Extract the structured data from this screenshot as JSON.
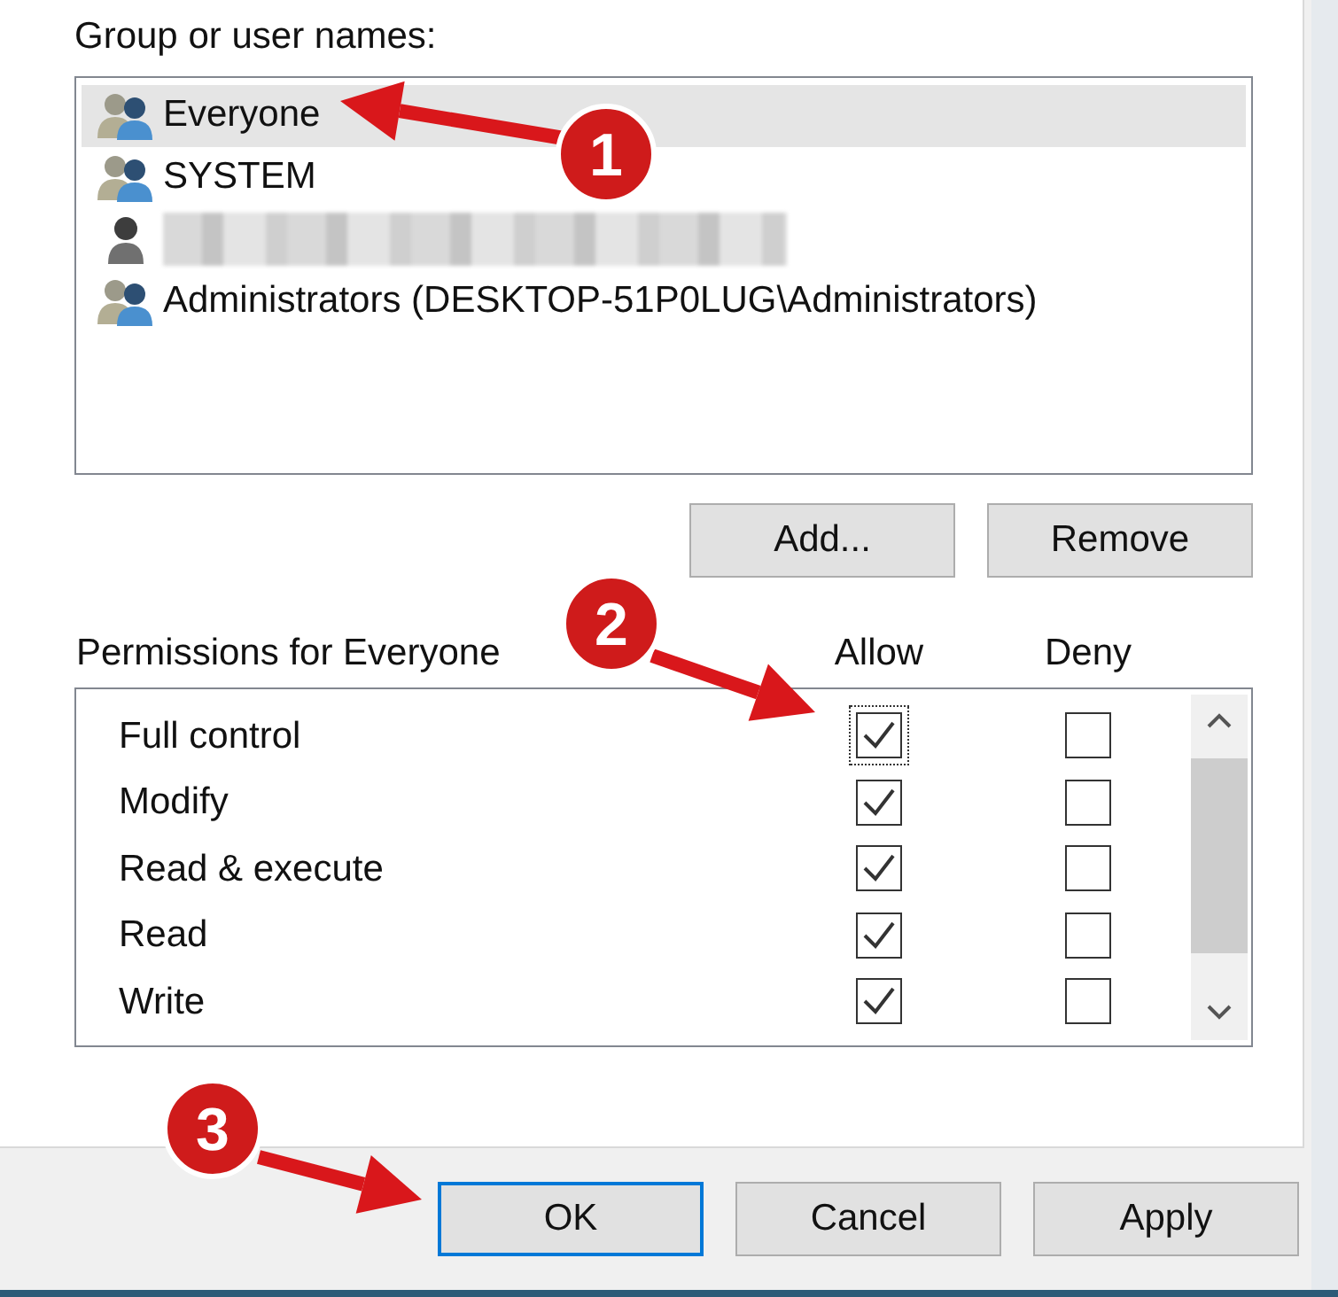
{
  "group_label": "Group or user names:",
  "accounts": [
    {
      "kind": "group",
      "name": "Everyone",
      "selected": true
    },
    {
      "kind": "group",
      "name": "SYSTEM",
      "selected": false
    },
    {
      "kind": "user",
      "redacted": true,
      "selected": false
    },
    {
      "kind": "group",
      "name": "Administrators (DESKTOP-51P0LUG\\Administrators)",
      "selected": false
    }
  ],
  "account_buttons": [
    "Add...",
    "Remove"
  ],
  "permissions_label": "Permissions for Everyone",
  "columns": [
    "Allow",
    "Deny"
  ],
  "permissions": [
    {
      "name": "Full control",
      "allow": true,
      "deny": false,
      "focused": true
    },
    {
      "name": "Modify",
      "allow": true,
      "deny": false,
      "focused": false
    },
    {
      "name": "Read & execute",
      "allow": true,
      "deny": false,
      "focused": false
    },
    {
      "name": "Read",
      "allow": true,
      "deny": false,
      "focused": false
    },
    {
      "name": "Write",
      "allow": true,
      "deny": false,
      "focused": false
    }
  ],
  "dialog_buttons": [
    {
      "label": "OK",
      "default": true
    },
    {
      "label": "Cancel",
      "default": false
    },
    {
      "label": "Apply",
      "default": false
    }
  ],
  "callouts": [
    "1",
    "2",
    "3"
  ]
}
